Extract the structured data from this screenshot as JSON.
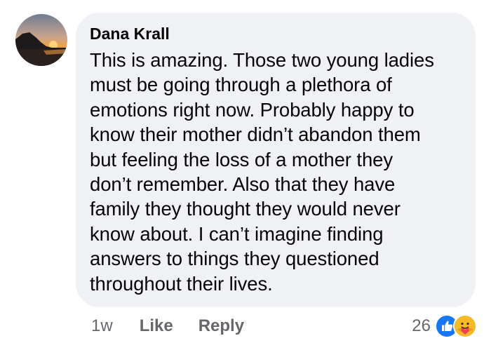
{
  "comment": {
    "author": "Dana Krall",
    "lines": [
      "This is amazing. Those two young ladies",
      "must be going through a plethora of",
      "emotions right now. Probably happy to",
      "know their mother didn’t abandon them",
      "but feeling the loss of a mother they",
      "don’t remember. Also that they have",
      "family they thought they would never",
      "know about. I can’t imagine finding",
      "answers to things they questioned",
      "throughout their lives."
    ],
    "timestamp": "1w",
    "like_label": "Like",
    "reply_label": "Reply",
    "reaction_count": "26",
    "reactions": [
      "like-icon",
      "care-icon"
    ]
  },
  "colors": {
    "bubble": "#eff1f4",
    "text": "#050505",
    "meta": "#65676b",
    "like_blue": "#1877f2",
    "care_yellow": "#f7b928"
  }
}
